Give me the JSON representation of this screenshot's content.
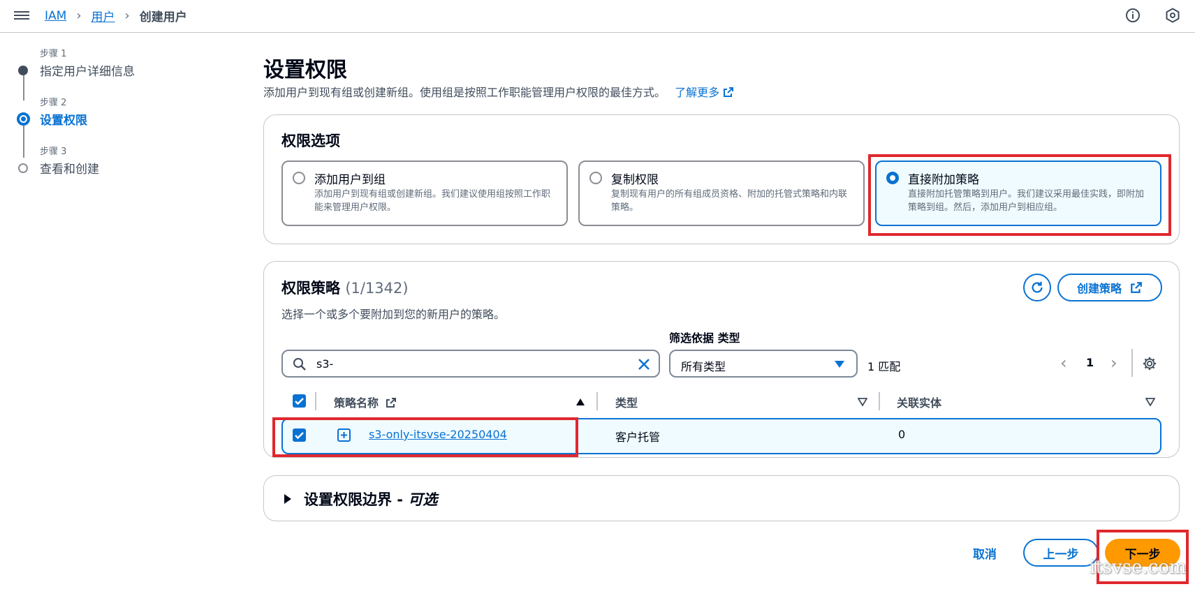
{
  "breadcrumb": {
    "root": "IAM",
    "users": "用户",
    "current": "创建用户"
  },
  "steps": [
    {
      "num": "步骤 1",
      "title": "指定用户详细信息",
      "state": "completed"
    },
    {
      "num": "步骤 2",
      "title": "设置权限",
      "state": "current"
    },
    {
      "num": "步骤 3",
      "title": "查看和创建",
      "state": "pending"
    }
  ],
  "page": {
    "title": "设置权限",
    "description": "添加用户到现有组或创建新组。使用组是按照工作职能管理用户权限的最佳方式。",
    "learn_more": "了解更多"
  },
  "options_panel": {
    "title": "权限选项",
    "options": [
      {
        "title": "添加用户到组",
        "desc": "添加用户到现有组或创建新组。我们建议使用组按照工作职能来管理用户权限。",
        "selected": false
      },
      {
        "title": "复制权限",
        "desc": "复制现有用户的所有组成员资格、附加的托管式策略和内联策略。",
        "selected": false
      },
      {
        "title": "直接附加策略",
        "desc": "直接附加托管策略到用户。我们建议采用最佳实践，即附加策略到组。然后，添加用户到相应组。",
        "selected": true
      }
    ]
  },
  "policies_panel": {
    "title": "权限策略",
    "count": "(1/1342)",
    "subtitle": "选择一个或多个要附加到您的新用户的策略。",
    "create_policy": "创建策略",
    "search_value": "s3-",
    "filter_label": "筛选依据 类型",
    "filter_value": "所有类型",
    "match_count": "1 匹配",
    "page_number": "1",
    "columns": [
      "策略名称",
      "类型",
      "关联实体"
    ],
    "rows": [
      {
        "name": "s3-only-itsvse-20250404",
        "type": "客户托管",
        "entities": "0",
        "checked": true
      }
    ]
  },
  "boundary_panel": {
    "title": "设置权限边界 - ",
    "optional": "可选"
  },
  "footer": {
    "cancel": "取消",
    "previous": "上一步",
    "next": "下一步"
  },
  "watermark": "itsvse.com",
  "colors": {
    "accent": "#0972d3",
    "primary_button": "#ff9900",
    "highlight": "#e0282e"
  }
}
